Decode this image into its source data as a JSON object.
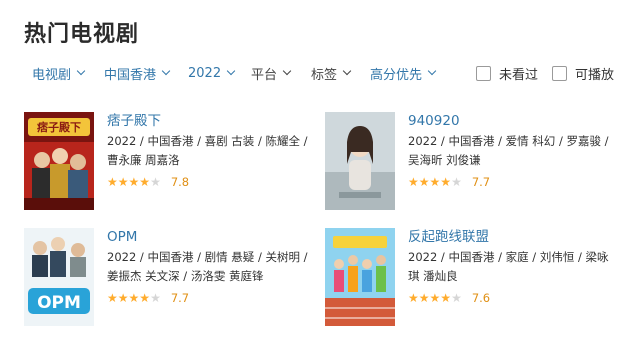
{
  "page_title": "热门电视剧",
  "filters": {
    "type": "电视剧",
    "region": "中国香港",
    "year": "2022",
    "platform": "平台",
    "tags": "标签",
    "sort": "高分优先",
    "unwatched": "未看过",
    "playable": "可播放"
  },
  "colors": {
    "link": "#3377aa",
    "star": "#ffac2d",
    "score": "#e09015"
  },
  "shows": [
    {
      "title": "痞子殿下",
      "meta": "2022 / 中国香港 / 喜剧 古装 / 陈耀全 / 曹永廉 周嘉洛",
      "rating": "7.8",
      "stars": 4,
      "poster_text": "痞子殿下"
    },
    {
      "title": "940920",
      "meta": "2022 / 中国香港 / 爱情 科幻 / 罗嘉骏 / 吴海昕 刘俊谦",
      "rating": "7.7",
      "stars": 4,
      "poster_text": ""
    },
    {
      "title": "OPM",
      "meta": "2022 / 中国香港 / 剧情 悬疑 / 关树明 / 姜振杰 关文深 / 汤洛雯 黄庭锋",
      "rating": "7.7",
      "stars": 4,
      "poster_text": "OPM"
    },
    {
      "title": "反起跑线联盟",
      "meta": "2022 / 中国香港 / 家庭 / 刘伟恒 / 梁咏琪 潘灿良",
      "rating": "7.6",
      "stars": 4,
      "poster_text": ""
    }
  ]
}
